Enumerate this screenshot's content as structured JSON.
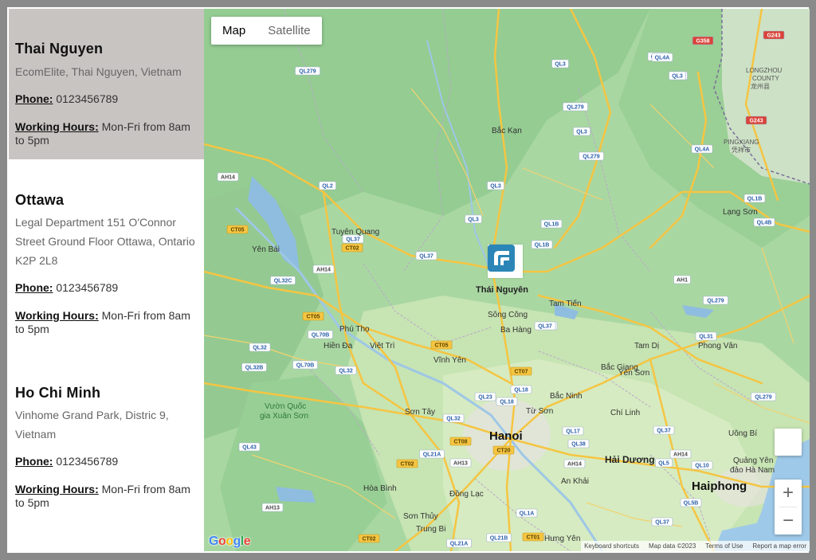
{
  "locations": [
    {
      "name": "Thai Nguyen",
      "address": "EcomElite, Thai Nguyen, Vietnam",
      "phone_label": "Phone:",
      "phone": " 0123456789",
      "hours_label": "Working Hours:",
      "hours": " Mon-Fri from 8am to 5pm"
    },
    {
      "name": "Ottawa",
      "address": "Legal Department 151 O'Connor Street Ground Floor Ottawa, Ontario K2P 2L8",
      "phone_label": "Phone:",
      "phone": " 0123456789",
      "hours_label": "Working Hours:",
      "hours": " Mon-Fri from 8am to 5pm"
    },
    {
      "name": "Ho Chi Minh",
      "address": "Vinhome Grand Park, Distric 9, Vietnam",
      "phone_label": "Phone:",
      "phone": " 0123456789",
      "hours_label": "Working Hours:",
      "hours": " Mon-Fri from 8am to 5pm"
    }
  ],
  "map": {
    "type_map": "Map",
    "type_satellite": "Satellite",
    "zoom_in": "+",
    "zoom_out": "−",
    "attribution": {
      "shortcuts": "Keyboard shortcuts",
      "data": "Map data ©2023",
      "terms": "Terms of Use",
      "report": "Report a map error"
    },
    "google": [
      "G",
      "o",
      "o",
      "g",
      "l",
      "e"
    ],
    "places": {
      "thai_nguyen": "Thái Nguyên",
      "hanoi": "Hanoi",
      "haiphong": "Haiphong",
      "bac_kan": "Bắc Kạn",
      "tuyen_quang": "Tuyên Quang",
      "yen_bai": "Yên Bái",
      "lang_son": "Lạng Sơn",
      "bac_giang": "Bắc Giang",
      "bac_ninh": "Bắc Ninh",
      "hai_duong": "Hải Dương",
      "vinh_yen": "Vĩnh Yên",
      "viet_tri": "Việt Trì",
      "phu_tho": "Phú Thọ",
      "son_tay": "Sơn Tây",
      "hoa_binh": "Hòa Bình",
      "hung_yen": "Hưng Yên",
      "chi_linh": "Chí Linh",
      "uong_bi": "Uông Bí",
      "song_cong": "Sông Công",
      "ba_hang": "Ba Hàng",
      "tam_tien": "Tam Tiến",
      "tam_di": "Tam Dị",
      "phong_van": "Phong Vân",
      "yen_son": "Yên Sơn",
      "tu_son": "Từ Sơn",
      "an_khai": "An Khải",
      "dong_lac": "Đồng Lạc",
      "son_thuy": "Sơn Thủy",
      "trung_bi": "Trung Bi",
      "hien_da": "Hiền Đa",
      "xuan_son_1": "Vườn Quốc",
      "xuan_son_2": "gia Xuân Sơn",
      "quang_yen_1": "Quảng Yên",
      "quang_yen_2": "đảo Hà Nam",
      "pingxiang_1": "PINGXIANG",
      "pingxiang_2": "凭祥市",
      "longzhou_1": "LONGZHOU",
      "longzhou_2": "COUNTY",
      "longzhou_3": "龙州县"
    },
    "roads": [
      "QL3",
      "QL279",
      "QL4A",
      "QL3",
      "QL279",
      "QL3",
      "QL279",
      "QL2",
      "QL3",
      "QL3",
      "QL37",
      "QL1B",
      "QL1B",
      "QL4B",
      "QL37",
      "CT05",
      "CT02",
      "QL32C",
      "AH14",
      "AH14",
      "AH1",
      "QL279",
      "QL37",
      "CT05",
      "QL70B",
      "QL32",
      "QL32",
      "QL32B",
      "QL70B",
      "CT05",
      "CT07",
      "QL18",
      "QL23",
      "QL32",
      "QL37",
      "QL31",
      "QL17",
      "QL38",
      "QL37",
      "CT08",
      "QL21A",
      "AH13",
      "CT20",
      "AH14",
      "QL18",
      "QL5",
      "QL10",
      "QL5B",
      "QL43",
      "CT02",
      "AH13",
      "QL1A",
      "QL21B",
      "CT01",
      "CT02",
      "QL21A",
      "QL37",
      "QL279",
      "AH14",
      "QL1B",
      "QL3",
      "G358",
      "G243",
      "G243",
      "QL4A",
      "QL4A"
    ]
  }
}
